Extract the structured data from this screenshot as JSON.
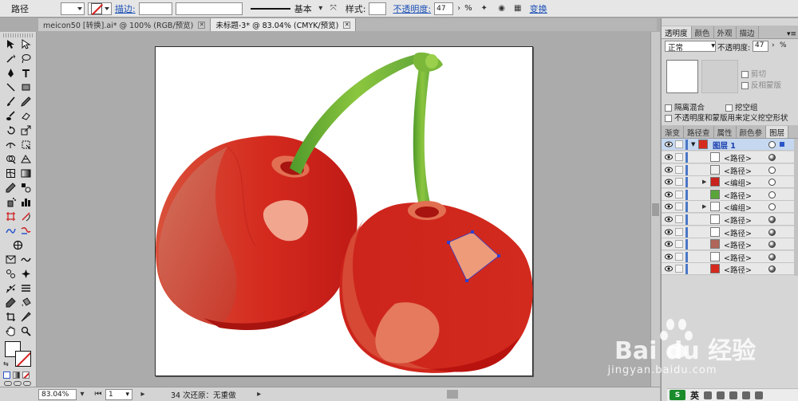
{
  "control_bar": {
    "object_type": "路径",
    "stroke_label": "描边:",
    "brush_label": "基本",
    "style_label": "样式:",
    "opacity_label": "不透明度:",
    "opacity_value": "47",
    "percent": "%",
    "transform_label": "变换"
  },
  "tabs": [
    {
      "label": "meicon50 [转换].ai* @ 100% (RGB/预览)",
      "active": false
    },
    {
      "label": "未标题-3* @ 83.04% (CMYK/预览)",
      "active": true
    }
  ],
  "status_bar": {
    "zoom": "83.04%",
    "artboard": "1",
    "message": "34 次还原：无重做"
  },
  "transparency_panel": {
    "tabs": [
      "透明度",
      "颜色",
      "外观",
      "描边"
    ],
    "blend_mode": "正常",
    "opacity_label": "不透明度:",
    "opacity_value": "47",
    "percent": "%",
    "make_mask": "剪切",
    "invert_mask": "反相蒙版",
    "isolate_blending": "隔离混合",
    "knockout_group": "挖空组",
    "opacity_mask_define": "不透明度和蒙版用来定义挖空形状"
  },
  "layers_panel": {
    "tabs": [
      "渐变",
      "路径查",
      "属性",
      "颜色参",
      "图层"
    ],
    "layer_name": "图层 1",
    "items": [
      {
        "name": "<路径>",
        "thumb": "#ffffff",
        "target": "filled",
        "arrow": false
      },
      {
        "name": "<路径>",
        "thumb": "#f0f0f0",
        "target": "empty",
        "arrow": false
      },
      {
        "name": "<编组>",
        "thumb": "#c8231e",
        "target": "empty",
        "arrow": true
      },
      {
        "name": "<路径>",
        "thumb": "#5aa53a",
        "target": "empty",
        "arrow": false
      },
      {
        "name": "<编组>",
        "thumb": "#ffffff",
        "target": "empty",
        "arrow": true
      },
      {
        "name": "<路径>",
        "thumb": "#ffffff",
        "target": "filled",
        "arrow": false
      },
      {
        "name": "<路径>",
        "thumb": "#ffffff",
        "target": "filled",
        "arrow": false
      },
      {
        "name": "<路径>",
        "thumb": "#b0675a",
        "target": "filled",
        "arrow": false
      },
      {
        "name": "<路径>",
        "thumb": "#ffffff",
        "target": "filled",
        "arrow": false
      },
      {
        "name": "<路径>",
        "thumb": "#d62a1f",
        "target": "filled",
        "arrow": false
      }
    ]
  },
  "taskbar": {
    "ime_label": "英"
  },
  "watermark": {
    "logo": "Bai du 经验",
    "url": "jingyan.baidu.com"
  }
}
